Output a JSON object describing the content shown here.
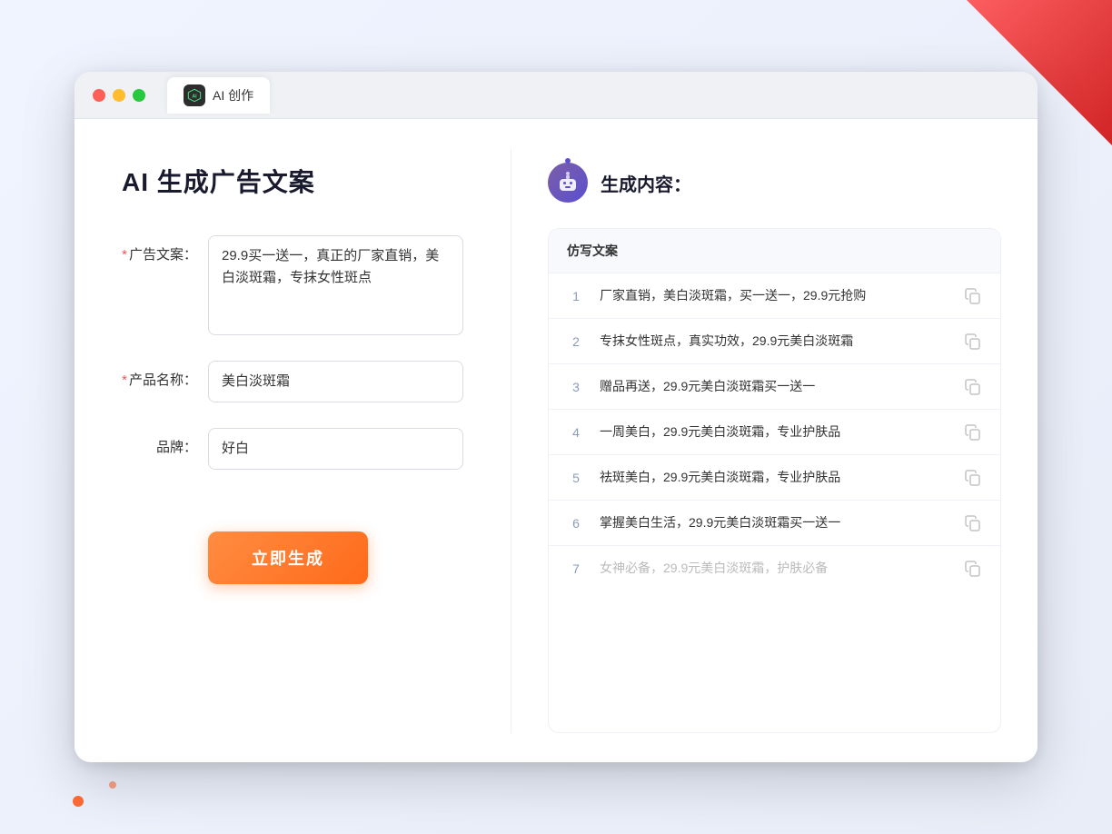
{
  "window": {
    "tab_title": "AI 创作",
    "traffic_red": "close",
    "traffic_yellow": "minimize",
    "traffic_green": "maximize"
  },
  "header": {
    "title": "AI 生成广告文案"
  },
  "form": {
    "ad_copy_label": "广告文案：",
    "ad_copy_required": "*",
    "ad_copy_value": "29.9买一送一，真正的厂家直销，美白淡斑霜，专抹女性斑点",
    "product_name_label": "产品名称：",
    "product_name_required": "*",
    "product_name_value": "美白淡斑霜",
    "brand_label": "品牌：",
    "brand_value": "好白",
    "generate_button": "立即生成"
  },
  "result": {
    "header_icon_label": "robot",
    "header_title": "生成内容：",
    "table_header": "仿写文案",
    "rows": [
      {
        "num": "1",
        "text": "厂家直销，美白淡斑霜，买一送一，29.9元抢购",
        "muted": false
      },
      {
        "num": "2",
        "text": "专抹女性斑点，真实功效，29.9元美白淡斑霜",
        "muted": false
      },
      {
        "num": "3",
        "text": "赠品再送，29.9元美白淡斑霜买一送一",
        "muted": false
      },
      {
        "num": "4",
        "text": "一周美白，29.9元美白淡斑霜，专业护肤品",
        "muted": false
      },
      {
        "num": "5",
        "text": "祛斑美白，29.9元美白淡斑霜，专业护肤品",
        "muted": false
      },
      {
        "num": "6",
        "text": "掌握美白生活，29.9元美白淡斑霜买一送一",
        "muted": false
      },
      {
        "num": "7",
        "text": "女神必备，29.9元美白淡斑霜，护肤必备",
        "muted": true
      }
    ]
  }
}
